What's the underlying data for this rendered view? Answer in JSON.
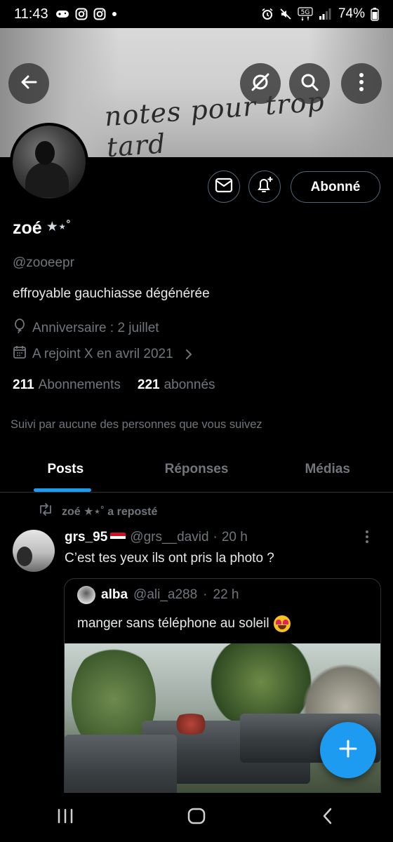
{
  "status_bar": {
    "time": "11:43",
    "battery": "74%",
    "network": "5G"
  },
  "header": {
    "banner_text": "notes pour trop tard",
    "buttons": [
      "back-arrow-icon",
      "grok-icon",
      "search-icon",
      "more-vertical-icon"
    ]
  },
  "profile": {
    "name": "zoé",
    "name_stars": "★⋆˚",
    "handle": "@zooeepr",
    "bio": "effroyable gauchiasse dégénérée",
    "birthday": "Anniversaire : 2 juillet",
    "joined": "A rejoint X en avril 2021",
    "following_count": "211",
    "following_label": "Abonnements",
    "followers_count": "221",
    "followers_label": "abonnés",
    "followed_by": "Suivi par aucune des personnes que vous suivez",
    "follow_button": "Abonné"
  },
  "tabs": [
    {
      "label": "Posts",
      "active": true
    },
    {
      "label": "Réponses",
      "active": false
    },
    {
      "label": "Médias",
      "active": false
    }
  ],
  "post": {
    "repost_label": "zoé ★⋆˚ a reposté",
    "author_name": "grs_95",
    "author_handle": "@grs__david",
    "time": "20 h",
    "separator": "·",
    "text": "C’est tes yeux ils ont pris la photo ?",
    "quote": {
      "author_name": "alba",
      "author_handle": "@ali_a288",
      "time": "22 h",
      "separator": "·",
      "text": "manger sans téléphone au soleil"
    }
  },
  "colors": {
    "accent": "#1d9bf0",
    "background": "#000000",
    "muted_text": "#71767b",
    "border": "#2f3336"
  }
}
